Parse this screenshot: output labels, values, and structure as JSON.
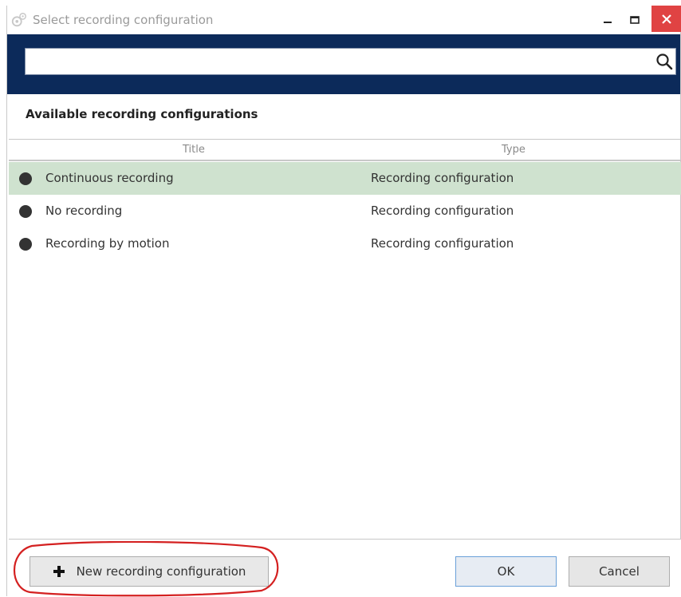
{
  "window": {
    "title": "Select recording configuration"
  },
  "search": {
    "value": "",
    "placeholder": ""
  },
  "section": {
    "title": "Available recording configurations"
  },
  "table": {
    "columns": [
      "Title",
      "Type"
    ],
    "rows": [
      {
        "title": "Continuous recording",
        "type": "Recording configuration",
        "selected": true
      },
      {
        "title": "No recording",
        "type": "Recording configuration",
        "selected": false
      },
      {
        "title": "Recording by motion",
        "type": "Recording configuration",
        "selected": false
      }
    ]
  },
  "footer": {
    "new_label": "New recording configuration",
    "ok_label": "OK",
    "cancel_label": "Cancel"
  },
  "colors": {
    "header_band": "#0c2a5a",
    "selected_row": "#cfe2cf",
    "close_button": "#e04343",
    "annotation_ring": "#d42020"
  },
  "icons": {
    "app": "gear-icon",
    "search": "search-icon",
    "new": "plus-icon",
    "minimize": "minimize-icon",
    "maximize": "maximize-icon",
    "close": "close-icon"
  }
}
